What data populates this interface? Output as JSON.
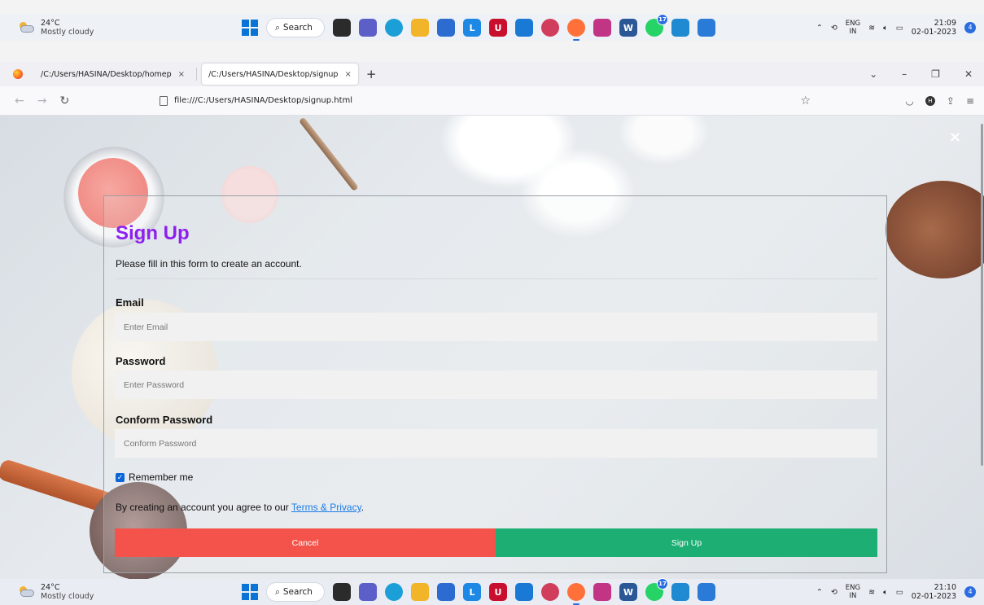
{
  "taskbar_top": {
    "temperature": "24°C",
    "condition": "Mostly cloudy",
    "search_label": "Search",
    "lang_top": "ENG",
    "lang_bottom": "IN",
    "time": "21:09",
    "date": "02-01-2023",
    "notification_count": "4",
    "whatsapp_badge": "17"
  },
  "taskbar_bottom": {
    "temperature": "24°C",
    "condition": "Mostly cloudy",
    "search_label": "Search",
    "lang_top": "ENG",
    "lang_bottom": "IN",
    "time": "21:10",
    "date": "02-01-2023",
    "notification_count": "4",
    "whatsapp_badge": "17"
  },
  "taskbar_apps": [
    {
      "name": "file-explorer-icon",
      "color": "#2b2b2b"
    },
    {
      "name": "teams-icon",
      "color": "#5b5fc7"
    },
    {
      "name": "edge-icon",
      "color": "#1b9fd6"
    },
    {
      "name": "folder-icon",
      "color": "#f2b529"
    },
    {
      "name": "store-icon",
      "color": "#2c6bd0"
    },
    {
      "name": "l-app-icon",
      "color": "#1e88e5"
    },
    {
      "name": "mcafee-icon",
      "color": "#c8102e"
    },
    {
      "name": "outlook-icon",
      "color": "#1b79d6"
    },
    {
      "name": "app-icon",
      "color": "#d13d5c"
    },
    {
      "name": "firefox-icon",
      "color": "#ff7139"
    },
    {
      "name": "instagram-icon",
      "color": "#c13584"
    },
    {
      "name": "word-icon",
      "color": "#2b5797"
    },
    {
      "name": "whatsapp-icon",
      "color": "#25d366"
    },
    {
      "name": "vscode-icon",
      "color": "#1f8ad2"
    },
    {
      "name": "photos-icon",
      "color": "#2a7ad8"
    }
  ],
  "browser": {
    "tabs": [
      {
        "title": "/C:/Users/HASINA/Desktop/homep",
        "close": "×"
      },
      {
        "title": "/C:/Users/HASINA/Desktop/signup",
        "close": "×"
      }
    ],
    "new_tab": "+",
    "url": "file:///C:/Users/HASINA/Desktop/signup.html"
  },
  "form": {
    "title": "Sign Up",
    "subtitle": "Please fill in this form to create an account.",
    "email_label": "Email",
    "email_placeholder": "Enter Email",
    "password_label": "Password",
    "password_placeholder": "Enter Password",
    "confirm_label": "Conform Password",
    "confirm_placeholder": "Conform Password",
    "remember_label": "Remember me",
    "remember_checked": true,
    "terms_prefix": "By creating an account you agree to our ",
    "terms_link": "Terms & Privacy",
    "terms_suffix": ".",
    "cancel_label": "Cancel",
    "signup_label": "Sign Up",
    "cancel_color": "#f3534a",
    "signup_color": "#1cae72",
    "title_color": "#8e1ff0"
  },
  "page": {
    "close_glyph": "×"
  }
}
